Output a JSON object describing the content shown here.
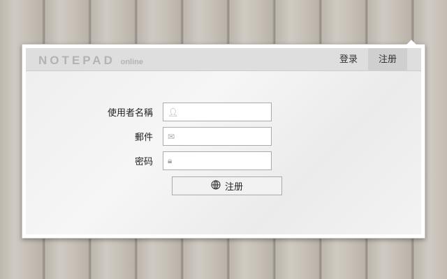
{
  "header": {
    "logo_main": "NOTEPAD",
    "logo_sub": "online",
    "nav": [
      {
        "label": "登录"
      },
      {
        "label": "注册",
        "active": true
      }
    ]
  },
  "form": {
    "username_label": "使用者名稱",
    "email_label": "郵件",
    "password_label": "密码",
    "submit_label": "注册"
  }
}
